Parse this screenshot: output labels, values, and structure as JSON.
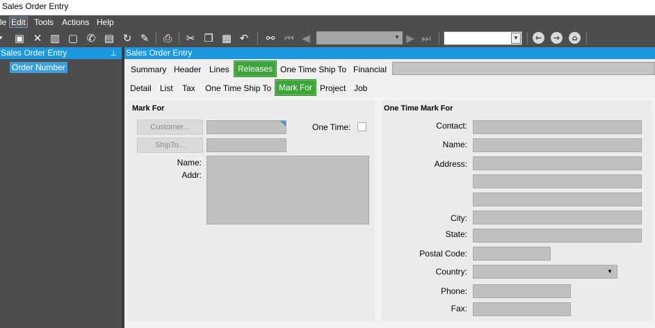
{
  "window": {
    "title": "Sales Order Entry"
  },
  "menu": {
    "file_partial": "le",
    "edit": "Edit",
    "tools": "Tools",
    "actions": "Actions",
    "help": "Help"
  },
  "toolbar": {
    "icons": [
      "new-icon",
      "save-icon",
      "delete-icon",
      "open-book-icon",
      "attach-icon",
      "phone-icon",
      "clipboard-icon",
      "refresh-icon",
      "broom-icon",
      "print-icon",
      "cut-icon",
      "copy-icon",
      "paste-icon",
      "undo-icon",
      "binoculars-icon",
      "first-record-icon",
      "prev-record-icon",
      "next-record-icon",
      "last-record-icon",
      "back-icon",
      "forward-icon",
      "home-icon"
    ],
    "record_selector_value": "",
    "quick_search_value": ""
  },
  "tree": {
    "header": "Sales Order Entry",
    "node_label": "Order Number"
  },
  "main": {
    "header": "Sales Order Entry",
    "tabs_primary": [
      {
        "label": "Summary"
      },
      {
        "label": "Header"
      },
      {
        "label": "Lines"
      },
      {
        "label": "Releases"
      },
      {
        "label": "One Time Ship To"
      },
      {
        "label": "Financial"
      }
    ],
    "tabs_secondary": [
      {
        "label": "Detail"
      },
      {
        "label": "List"
      },
      {
        "label": "Tax"
      },
      {
        "label": "One Time Ship To"
      },
      {
        "label": "Mark For"
      },
      {
        "label": "Project"
      },
      {
        "label": "Job"
      }
    ],
    "active_primary_tab": "Releases",
    "active_secondary_tab": "Mark For"
  },
  "mark_for": {
    "title": "Mark For",
    "customer_button": "Customer...",
    "shipto_button": "ShipTo...",
    "one_time_label": "One Time:",
    "one_time_checked": false,
    "name_label": "Name:",
    "addr_label": "Addr:",
    "customer_value": "",
    "shipto_value": "",
    "name_addr_value": ""
  },
  "one_time_mark_for": {
    "title": "One Time Mark For",
    "contact_label": "Contact:",
    "name_label": "Name:",
    "address_label": "Address:",
    "city_label": "City:",
    "state_label": "State:",
    "postal_code_label": "Postal Code:",
    "country_label": "Country:",
    "phone_label": "Phone:",
    "fax_label": "Fax:",
    "contact_value": "",
    "name_value": "",
    "address1_value": "",
    "address2_value": "",
    "address3_value": "",
    "city_value": "",
    "state_value": "",
    "postal_code_value": "",
    "country_value": "",
    "phone_value": "",
    "fax_value": ""
  },
  "colors": {
    "accent_blue": "#1b98e0",
    "active_tab_green": "#3ea53a",
    "dark_chrome": "#4d4d4d"
  }
}
